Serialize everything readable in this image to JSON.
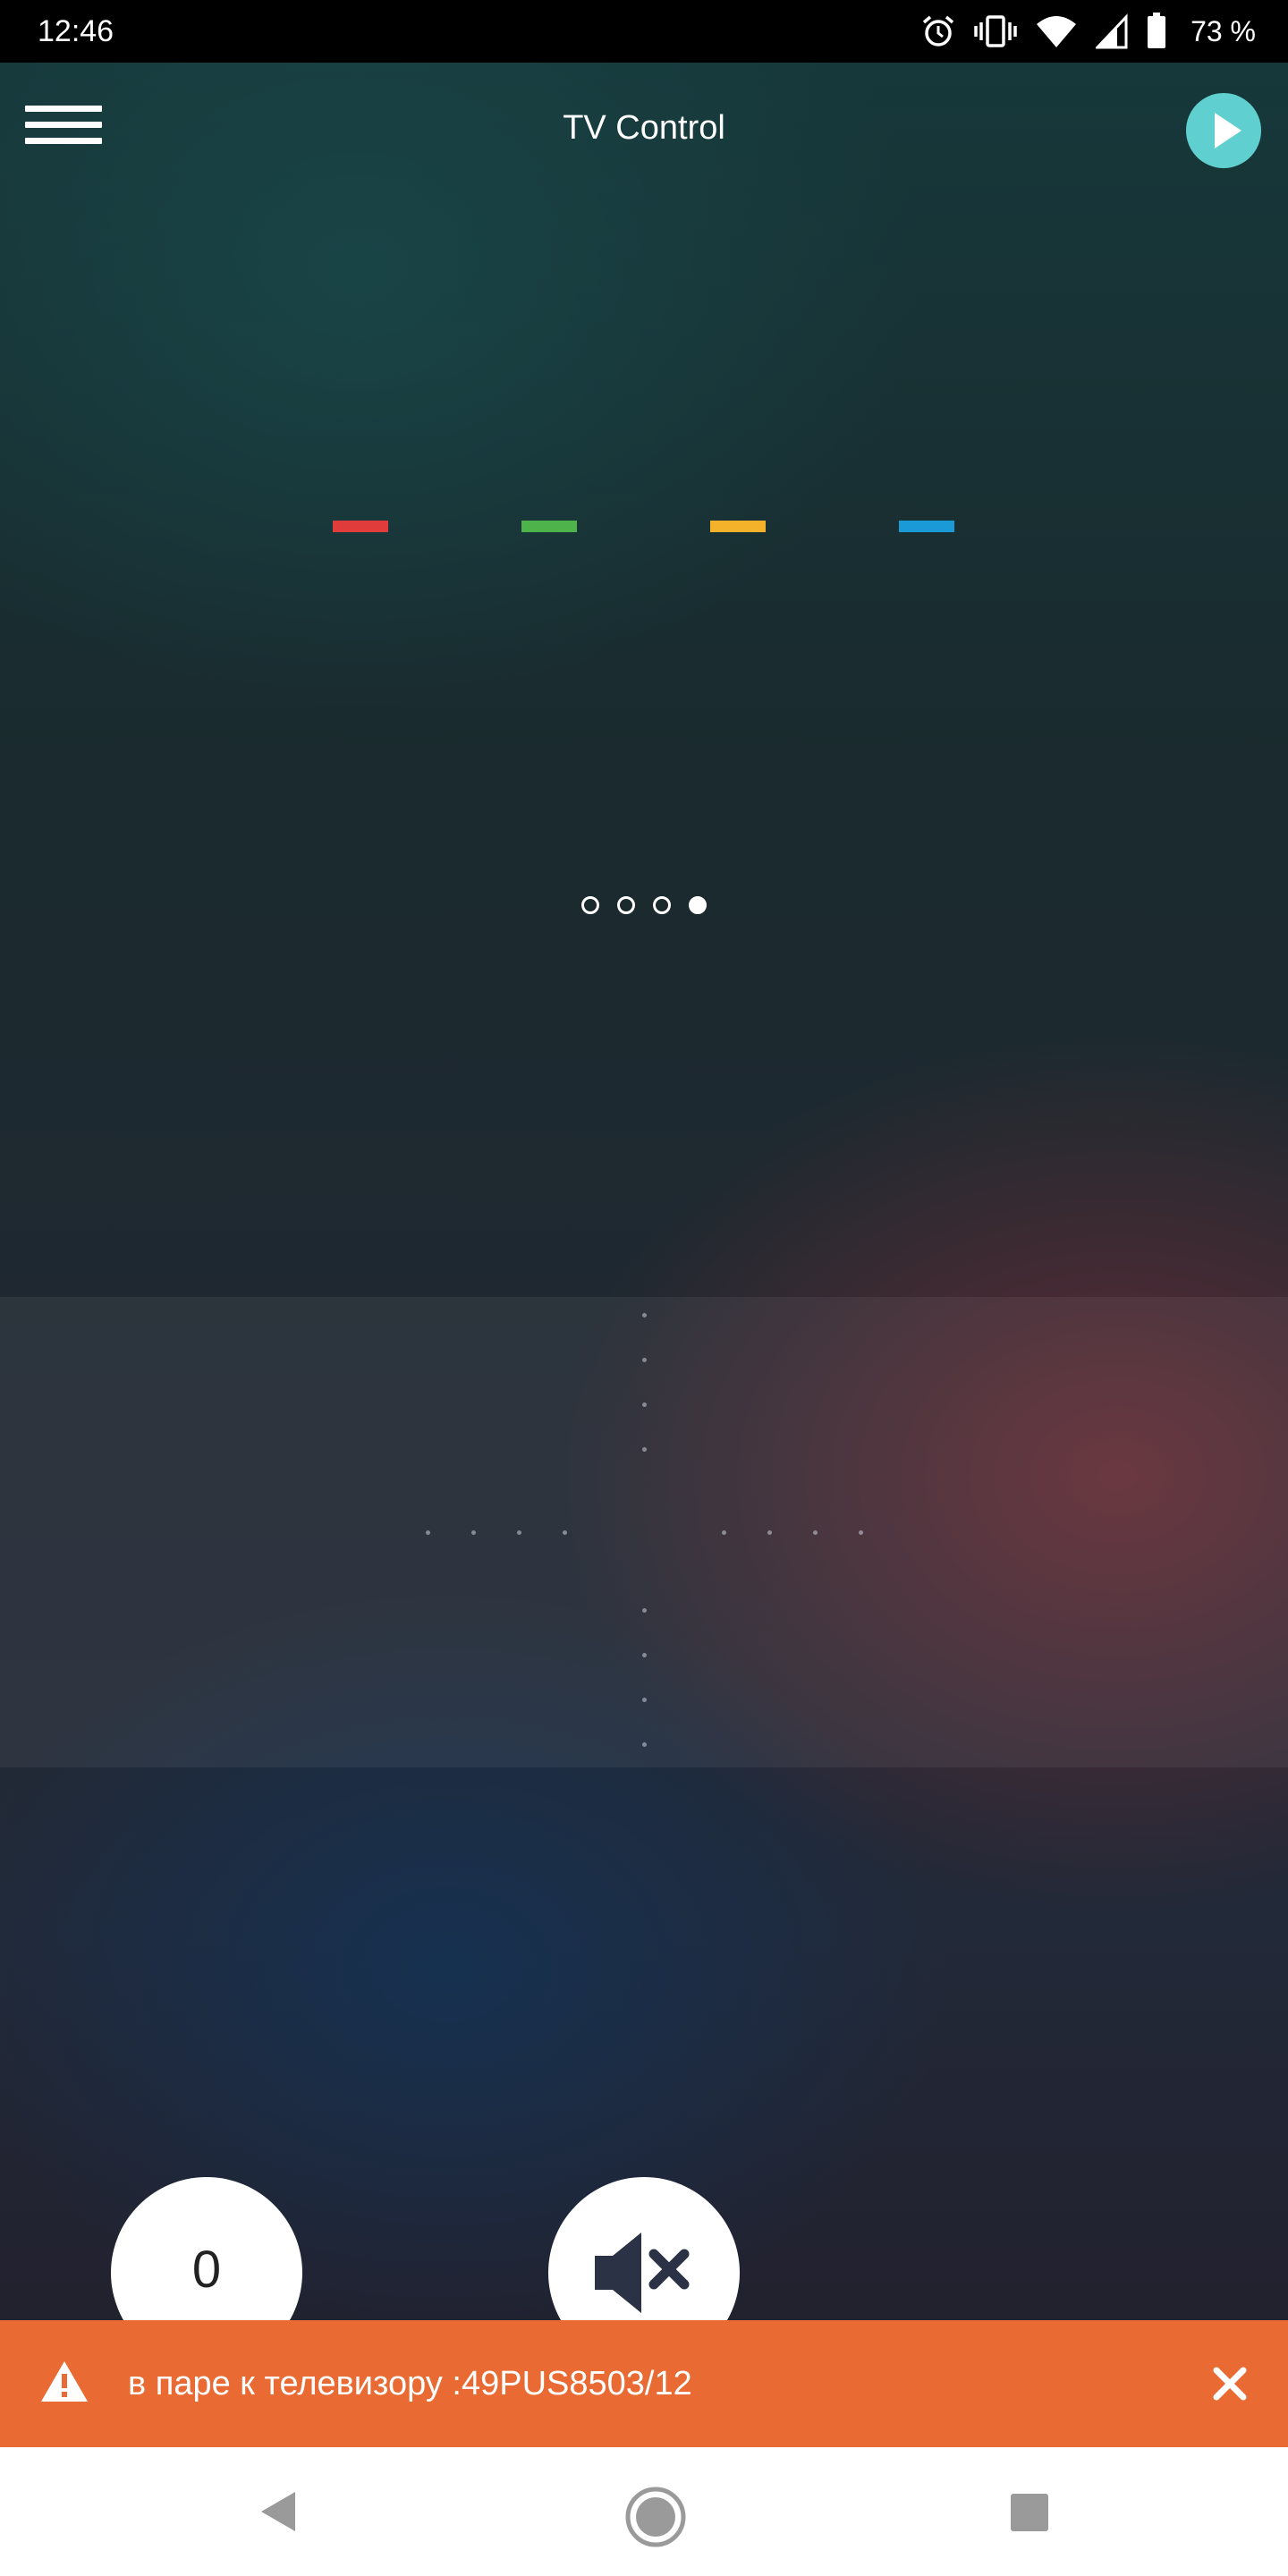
{
  "status_bar": {
    "time": "12:46",
    "battery": "73 %",
    "icons": [
      "alarm-icon",
      "vibrate-icon",
      "wifi-icon",
      "cell-signal-icon",
      "battery-icon"
    ]
  },
  "header": {
    "title": "TV Control",
    "menu_icon": "hamburger-menu-icon",
    "play_icon": "play-icon",
    "play_color": "#5fcfcf"
  },
  "color_keys": [
    {
      "name": "red",
      "color": "#e03c3c"
    },
    {
      "name": "green",
      "color": "#4db34a"
    },
    {
      "name": "yellow",
      "color": "#f3b22a"
    },
    {
      "name": "blue",
      "color": "#1a9ad6"
    }
  ],
  "pager": {
    "count": 4,
    "active_index": 3
  },
  "buttons": {
    "zero_label": "0",
    "mute_icon": "mute-icon"
  },
  "banner": {
    "text": "в паре к телевизору :49PUS8503/12",
    "icon": "warning-icon",
    "close_icon": "close-icon",
    "color": "#e96a32"
  },
  "nav": {
    "back": "back-icon",
    "home": "home-icon",
    "recents": "recents-icon"
  }
}
